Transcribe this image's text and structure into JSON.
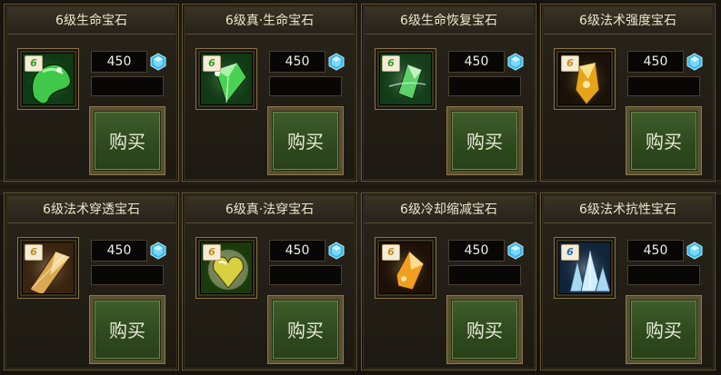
{
  "currency_icon": "blue-gem-icon",
  "buy_label": "购买",
  "items": [
    {
      "title": "6级生命宝石",
      "level": "6",
      "price": "450",
      "icon": "green-life-gem-icon",
      "colors": {
        "bg": "#0f3a14",
        "gem": "#3fc84a",
        "hi": "#b8ffb0",
        "badge": "#3a9a2a"
      }
    },
    {
      "title": "6级真·生命宝石",
      "level": "6",
      "price": "450",
      "icon": "green-true-life-gem-icon",
      "colors": {
        "bg": "#0f3a14",
        "gem": "#4bd255",
        "hi": "#d8ffd0",
        "badge": "#3a9a2a"
      }
    },
    {
      "title": "6级生命恢复宝石",
      "level": "6",
      "price": "450",
      "icon": "green-life-regen-gem-icon",
      "colors": {
        "bg": "#123d18",
        "gem": "#5fd06a",
        "hi": "#e4ffe0",
        "badge": "#3a9a2a"
      }
    },
    {
      "title": "6级法术强度宝石",
      "level": "6",
      "price": "450",
      "icon": "gold-spell-power-gem-icon",
      "colors": {
        "bg": "#1a1208",
        "gem": "#e6a41a",
        "hi": "#fff1a8",
        "badge": "#c78a1a"
      }
    },
    {
      "title": "6级法术穿透宝石",
      "level": "6",
      "price": "450",
      "icon": "amber-spell-penetration-gem-icon",
      "colors": {
        "bg": "#3a2410",
        "gem": "#d9a850",
        "hi": "#fff0c0",
        "badge": "#c78a1a"
      }
    },
    {
      "title": "6级真·法穿宝石",
      "level": "6",
      "price": "450",
      "icon": "yellow-true-penetration-gem-icon",
      "colors": {
        "bg": "#1a3a0c",
        "gem": "#d8d040",
        "hi": "#fffad0",
        "badge": "#c78a1a"
      }
    },
    {
      "title": "6级冷却缩减宝石",
      "level": "6",
      "price": "450",
      "icon": "orange-cooldown-gem-icon",
      "colors": {
        "bg": "#1e1006",
        "gem": "#f0a020",
        "hi": "#fff2b0",
        "badge": "#c78a1a"
      }
    },
    {
      "title": "6级法术抗性宝石",
      "level": "6",
      "price": "450",
      "icon": "blue-magic-resist-gem-icon",
      "colors": {
        "bg": "#10243a",
        "gem": "#a8d8f0",
        "hi": "#ffffff",
        "badge": "#2a6ab8"
      }
    }
  ]
}
